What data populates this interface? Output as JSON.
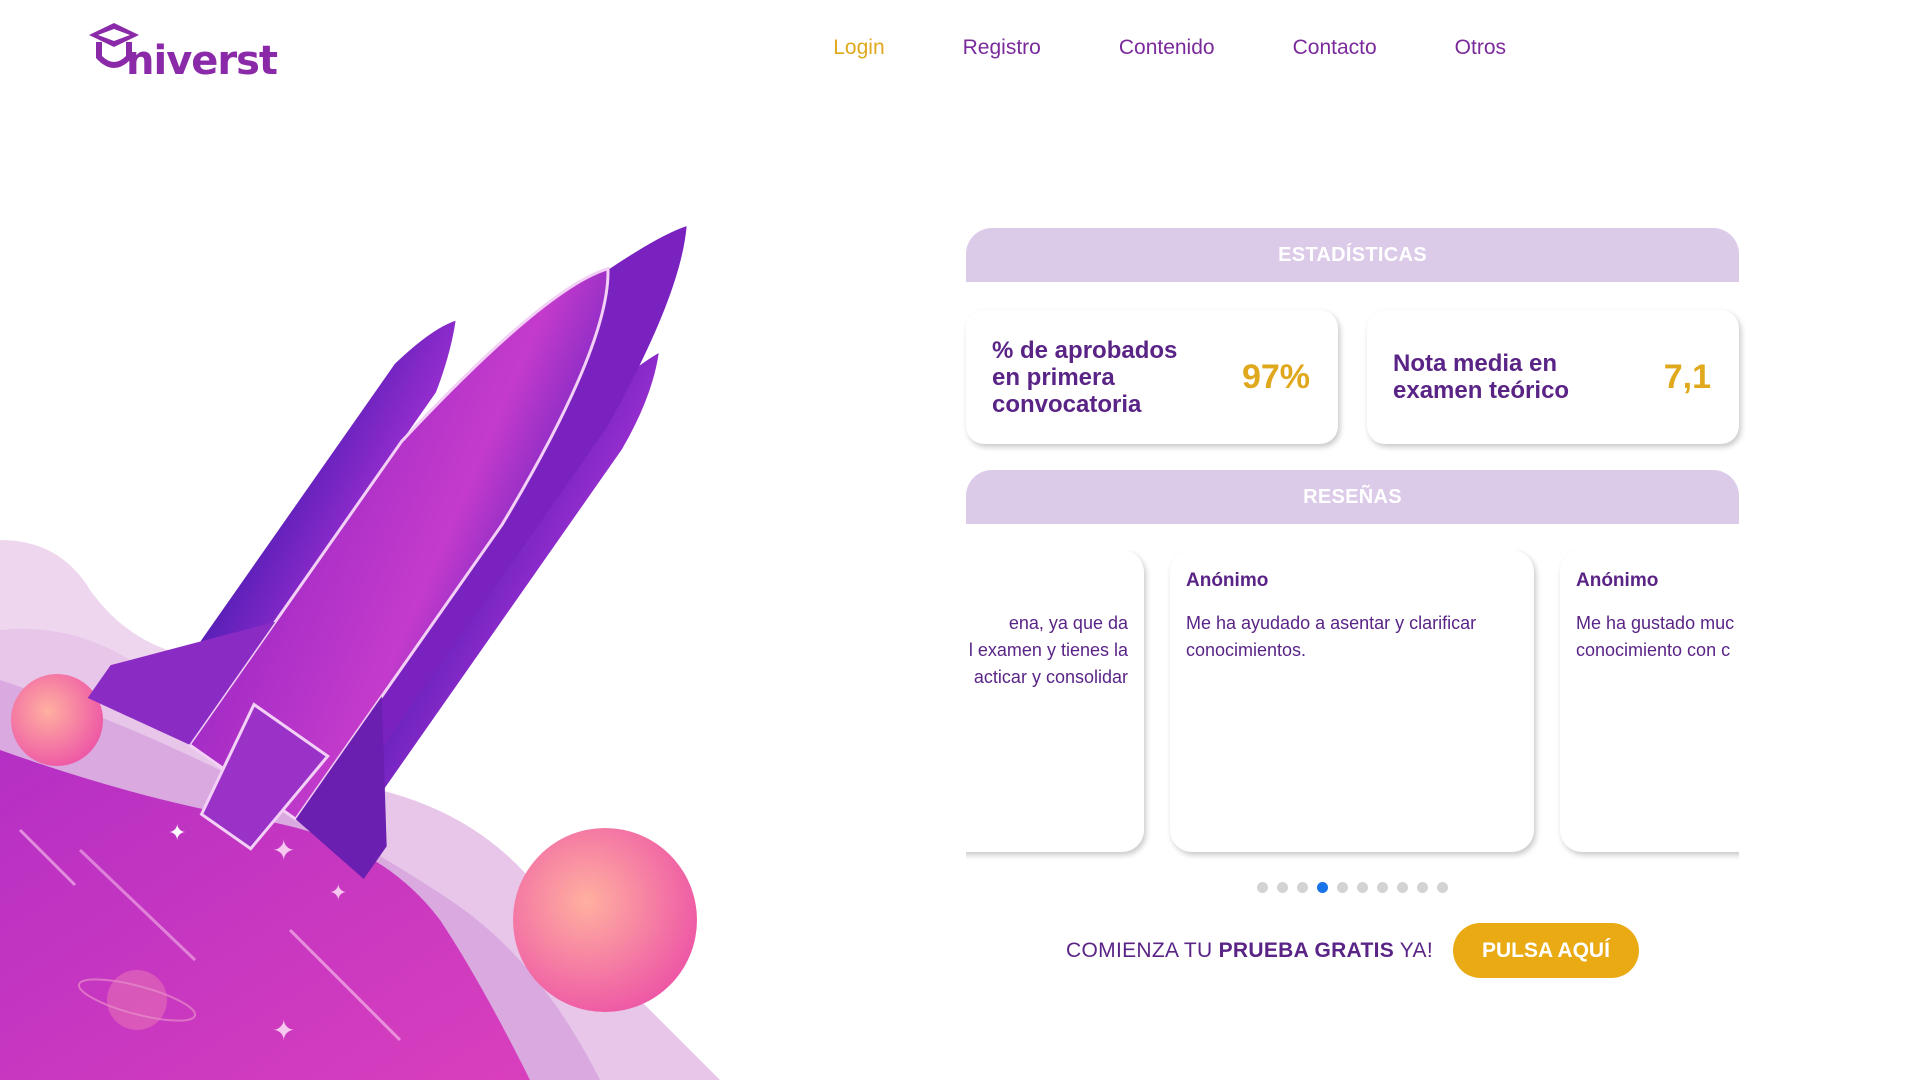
{
  "brand": {
    "name": "niverst"
  },
  "nav": {
    "items": [
      {
        "label": "Login",
        "active": true
      },
      {
        "label": "Registro"
      },
      {
        "label": "Contenido"
      },
      {
        "label": "Contacto"
      },
      {
        "label": "Otros"
      }
    ]
  },
  "stats": {
    "title": "ESTADÍSTICAS",
    "cards": [
      {
        "label": "% de aprobados en primera convocatoria",
        "value": "97%"
      },
      {
        "label": "Nota media en examen teórico",
        "value": "7,1"
      }
    ]
  },
  "reviews": {
    "title": "RESEÑAS",
    "items": [
      {
        "author": "",
        "lines": [
          "ena, ya que da",
          "l examen y tienes la",
          "acticar y consolidar"
        ]
      },
      {
        "author": "Anónimo",
        "text": "Me ha ayudado a asentar y clarificar conocimientos."
      },
      {
        "author": "Anónimo",
        "lines": [
          "Me ha gustado muc",
          "conocimiento con c"
        ]
      }
    ],
    "dot_count": 10,
    "active_dot": 3
  },
  "cta": {
    "text_prefix": "COMIENZA TU ",
    "text_bold": "PRUEBA GRATIS",
    "text_suffix": " YA!",
    "button_label": "PULSA AQUÍ"
  },
  "colors": {
    "purple": "#5a2487",
    "nav_purple": "#7b2a9c",
    "gold": "#e0a81c",
    "section_header": "#dccbe8",
    "active_dot": "#1a73e8"
  }
}
